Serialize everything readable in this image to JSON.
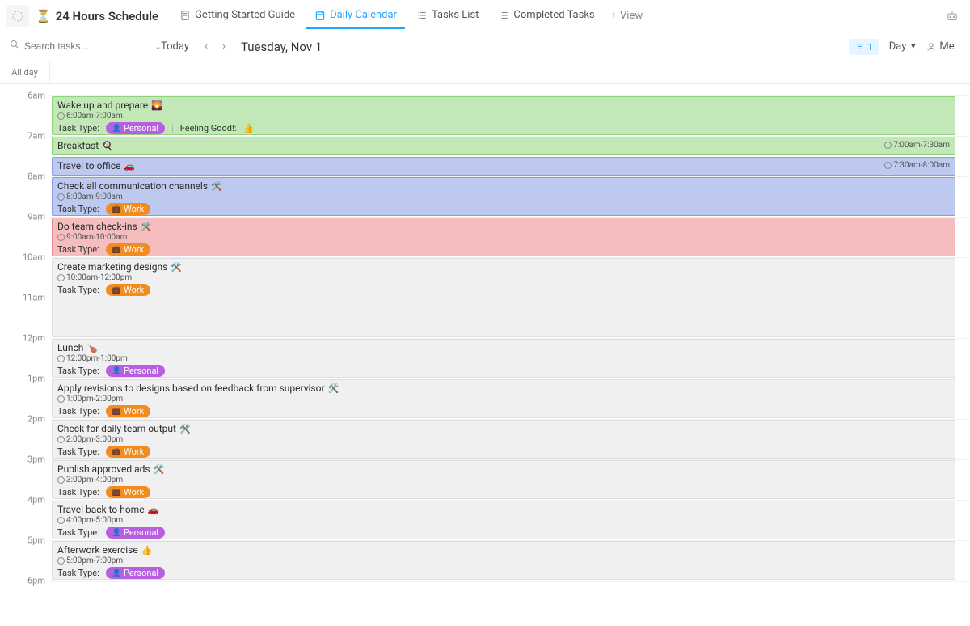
{
  "header": {
    "title": "24 Hours Schedule",
    "title_emoji": "⏳",
    "tabs": [
      {
        "label": "Getting Started Guide",
        "icon": "doc"
      },
      {
        "label": "Daily Calendar",
        "icon": "calendar",
        "active": true
      },
      {
        "label": "Tasks List",
        "icon": "list"
      },
      {
        "label": "Completed Tasks",
        "icon": "list"
      }
    ],
    "add_view": "View"
  },
  "toolbar": {
    "search_placeholder": "Search tasks...",
    "today": "Today",
    "date": "Tuesday, Nov 1",
    "filter_count": "1",
    "view_mode": "Day",
    "me": "Me"
  },
  "allday_label": "All day",
  "hourHeight": 50,
  "startHour": 6,
  "hours": [
    "6am",
    "7am",
    "8am",
    "9am",
    "10am",
    "11am",
    "12pm",
    "1pm",
    "2pm",
    "3pm",
    "4pm",
    "5pm",
    "6pm"
  ],
  "task_type_label": "Task Type:",
  "feeling_label": "Feeling Good!:",
  "badges": {
    "personal": "Personal",
    "work": "Work"
  },
  "events": [
    {
      "title": "Wake up and prepare",
      "emoji": "🌄",
      "start": 6.0,
      "end": 7.0,
      "time": "6:00am-7:00am",
      "color": "green",
      "type": "personal",
      "feeling": "👍",
      "showTime": "left"
    },
    {
      "title": "Breakfast",
      "emoji": "🍳",
      "start": 7.0,
      "end": 7.5,
      "time": "7:00am-7:30am",
      "color": "green",
      "type": "personal",
      "compact": true,
      "showTime": "right"
    },
    {
      "title": "Travel to office",
      "emoji": "🚗",
      "start": 7.5,
      "end": 8.0,
      "time": "7:30am-8:00am",
      "color": "blue",
      "type": "personal",
      "compact": true,
      "showTime": "right"
    },
    {
      "title": "Check all communication channels",
      "emoji": "🛠️",
      "start": 8.0,
      "end": 9.0,
      "time": "8:00am-9:00am",
      "color": "blue",
      "type": "work",
      "showTime": "left"
    },
    {
      "title": "Do team check-ins",
      "emoji": "🛠️",
      "start": 9.0,
      "end": 10.0,
      "time": "9:00am-10:00am",
      "color": "red",
      "type": "work",
      "showTime": "left"
    },
    {
      "title": "Create marketing designs",
      "emoji": "🛠️",
      "start": 10.0,
      "end": 12.0,
      "time": "10:00am-12:00pm",
      "color": "gray",
      "type": "work",
      "showTime": "left"
    },
    {
      "title": "Lunch",
      "emoji": "🍗",
      "start": 12.0,
      "end": 13.0,
      "time": "12:00pm-1:00pm",
      "color": "gray",
      "type": "personal",
      "showTime": "left"
    },
    {
      "title": "Apply revisions to designs based on feedback from supervisor",
      "emoji": "🛠️",
      "start": 13.0,
      "end": 14.0,
      "time": "1:00pm-2:00pm",
      "color": "gray",
      "type": "work",
      "showTime": "left"
    },
    {
      "title": "Check for daily team output",
      "emoji": "🛠️",
      "start": 14.0,
      "end": 15.0,
      "time": "2:00pm-3:00pm",
      "color": "gray",
      "type": "work",
      "showTime": "left"
    },
    {
      "title": "Publish approved ads",
      "emoji": "🛠️",
      "start": 15.0,
      "end": 16.0,
      "time": "3:00pm-4:00pm",
      "color": "gray",
      "type": "work",
      "showTime": "left"
    },
    {
      "title": "Travel back to home",
      "emoji": "🚗",
      "start": 16.0,
      "end": 17.0,
      "time": "4:00pm-5:00pm",
      "color": "gray",
      "type": "personal",
      "showTime": "left"
    },
    {
      "title": "Afterwork exercise",
      "emoji": "👍",
      "start": 17.0,
      "end": 18.0,
      "time": "5:00pm-7:00pm",
      "color": "gray",
      "type": "personal",
      "showTime": "left"
    }
  ]
}
